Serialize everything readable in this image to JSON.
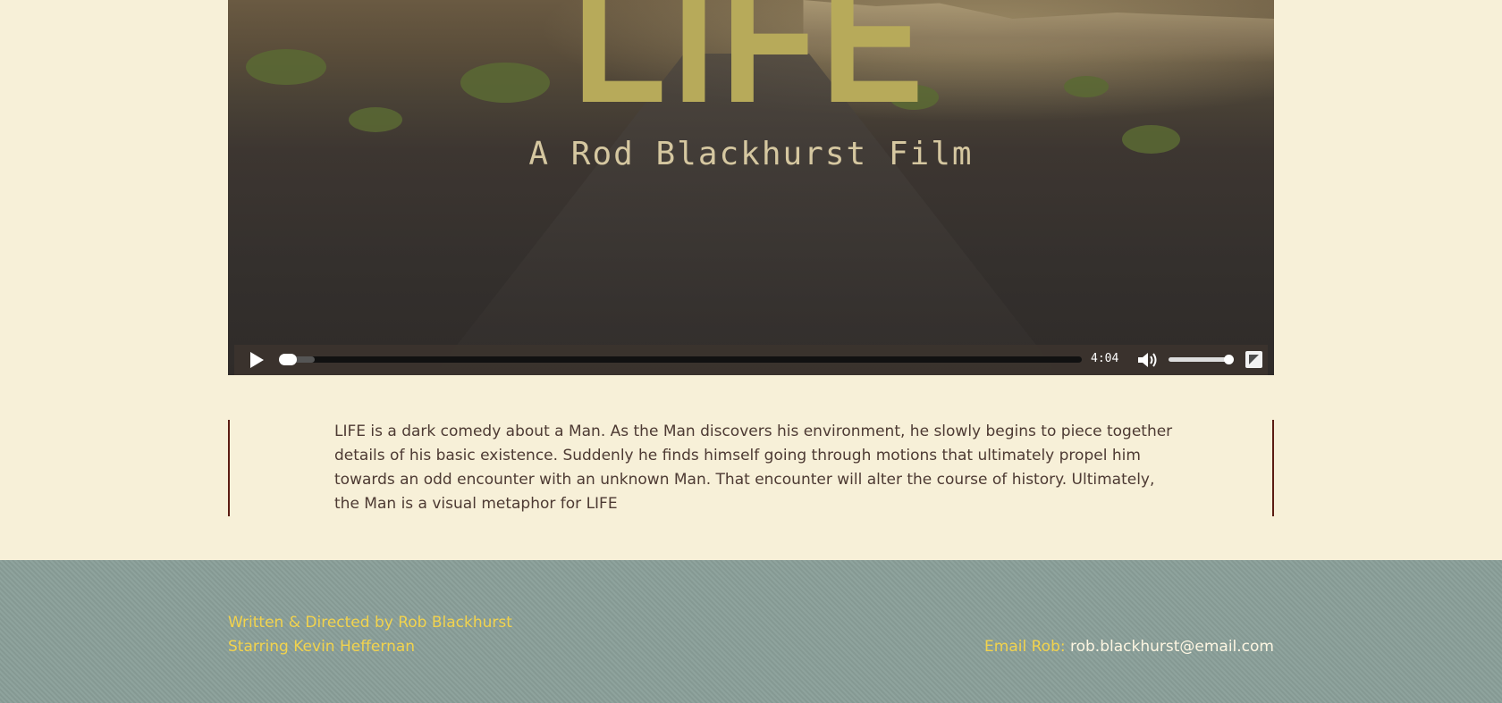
{
  "video": {
    "title": "LIFE",
    "subtitle": "A Rod Blackhurst Film",
    "duration": "4:04",
    "progress_fraction": 0.0,
    "volume_fraction": 1.0
  },
  "description": "LIFE is a dark comedy about a Man. As the Man discovers his environment, he slowly begins to piece together details of his basic existence. Suddenly he finds himself going through motions that ultimately propel him towards an odd encounter with an unknown Man. That encounter will alter the course of history. Ultimately, the Man is a visual metaphor for LIFE",
  "footer": {
    "credit_line_1": "Written & Directed by Rob Blackhurst",
    "credit_line_2": "Starring Kevin Heffernan",
    "email_label": "Email Rob:",
    "email_address": "rob.blackhurst@email.com"
  },
  "colors": {
    "background": "#f7f0d8",
    "footer_bg": "#8a9f99",
    "accent_yellow": "#f2d34d",
    "border_maroon": "#5b1c12"
  }
}
